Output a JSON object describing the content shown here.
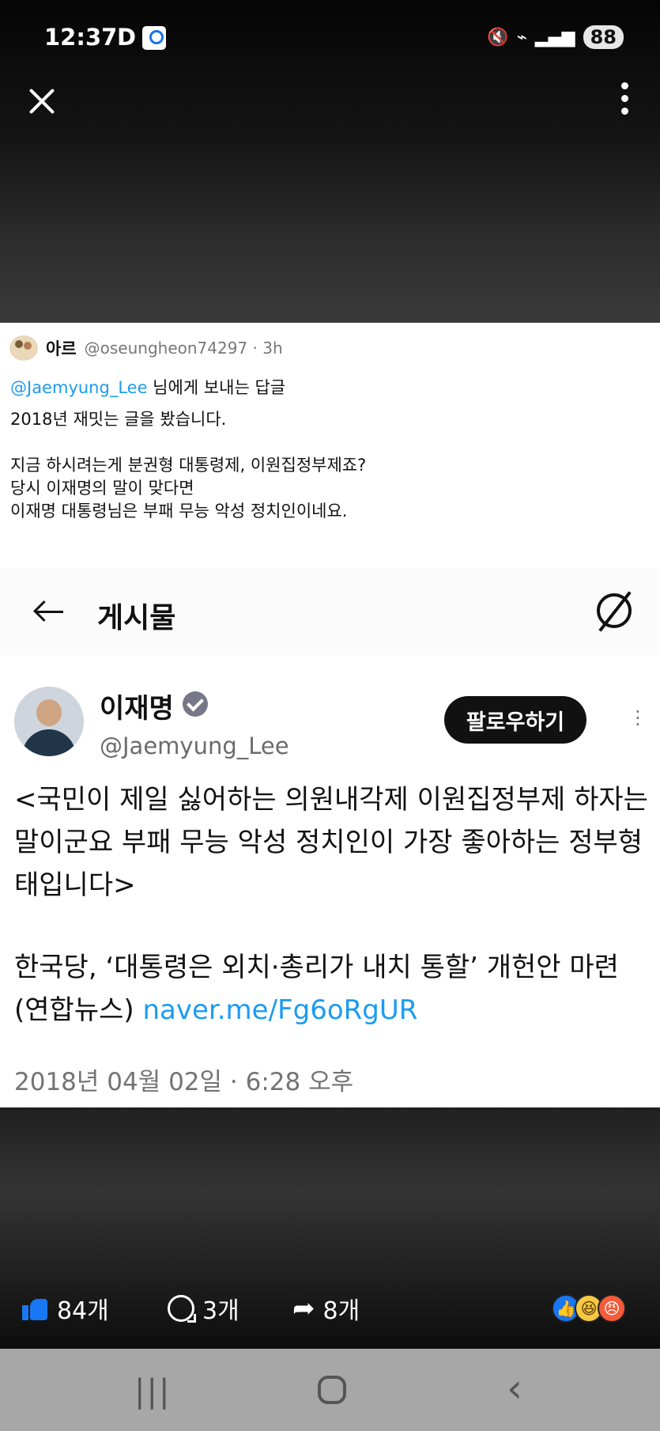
{
  "status_bar": {
    "time": "12:37",
    "indicator": "D",
    "battery": "88",
    "icons": [
      "mute-icon",
      "wifi-icon",
      "signal-icon"
    ]
  },
  "viewer": {
    "close_icon": "close-icon",
    "more_icon": "vertical-more-icon"
  },
  "reply": {
    "author": "아르",
    "meta": "@oseungheon74297 · 3h",
    "mention": "@Jaemyung_Lee",
    "mention_suffix": " 님에게 보내는 답글",
    "body": "2018년 재밋는 글을 봤습니다.\n\n지금 하시려는게 분권형 대통령제, 이원집정부제죠?\n당시 이재명의 말이 맞다면\n이재명 대통령님은 부패 무능 악성 정치인이네요."
  },
  "post": {
    "header_title": "게시물",
    "author_name": "이재명",
    "handle": "@Jaemyung_Lee",
    "follow_label": "팔로우하기",
    "text": "<국민이 제일 싫어하는 의원내각제 이원집정부제 하자는 말이군요 부패 무능 악성 정치인이 가장 좋아하는 정부형태입니다>",
    "link_prefix": "한국당, ‘대통령은 외치·총리가 내치 통할’ 개헌안 마련 (연합뉴스) ",
    "link": "naver.me/Fg6oRgUR",
    "date": "2018년 04월 02일 · 6:28 오후"
  },
  "actions": {
    "likes": "84개",
    "comments": "3개",
    "shares": "8개",
    "reaction_icons": [
      "like-reaction",
      "haha-reaction",
      "angry-reaction"
    ]
  },
  "colors": {
    "accent": "#1d9bf0",
    "facebook_blue": "#1877f2"
  }
}
